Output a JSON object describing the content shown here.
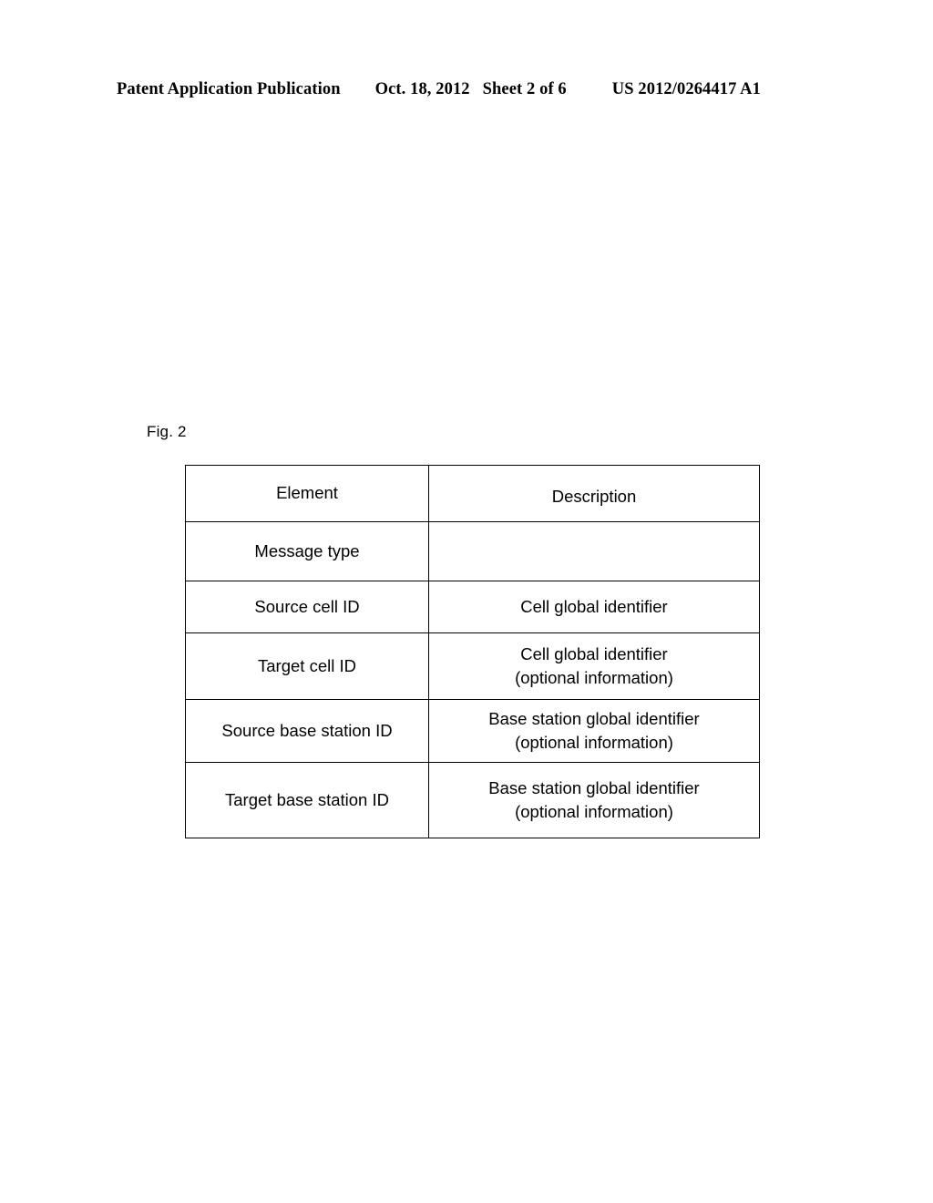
{
  "header": {
    "publication": "Patent Application Publication",
    "date": "Oct. 18, 2012",
    "sheet": "Sheet 2 of 6",
    "patent_number": "US 2012/0264417 A1"
  },
  "figure": {
    "label": "Fig. 2",
    "table": {
      "columns": [
        "Element",
        "Description"
      ],
      "rows": [
        {
          "element": "Message type",
          "description_line1": "",
          "description_line2": ""
        },
        {
          "element": "Source cell ID",
          "description_line1": "Cell global identifier",
          "description_line2": ""
        },
        {
          "element": "Target cell ID",
          "description_line1": "Cell global identifier",
          "description_line2": "(optional information)"
        },
        {
          "element": "Source base station ID",
          "description_line1": "Base station global identifier",
          "description_line2": "(optional information)"
        },
        {
          "element": "Target base station ID",
          "description_line1": "Base station global identifier",
          "description_line2": "(optional information)"
        }
      ]
    }
  },
  "colors": {
    "page_background": "#ffffff",
    "ink": "#000000",
    "table_border": "#000000"
  }
}
